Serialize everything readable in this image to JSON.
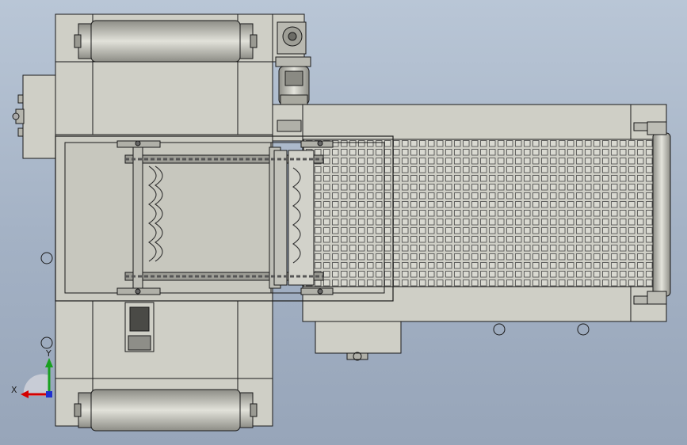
{
  "view": {
    "background_top": "#b9c6d6",
    "background_bottom": "#97a5b9",
    "part_fill": "#cfcfc6",
    "part_fill_dark": "#a9a9a0",
    "line_color": "#1a1a1a",
    "mesh_hole_color": "#8f9290"
  },
  "triad": {
    "x_label": "X",
    "y_label": "Y",
    "x_color": "#d40000",
    "y_color": "#18a020",
    "z_color": "#2030d0"
  }
}
